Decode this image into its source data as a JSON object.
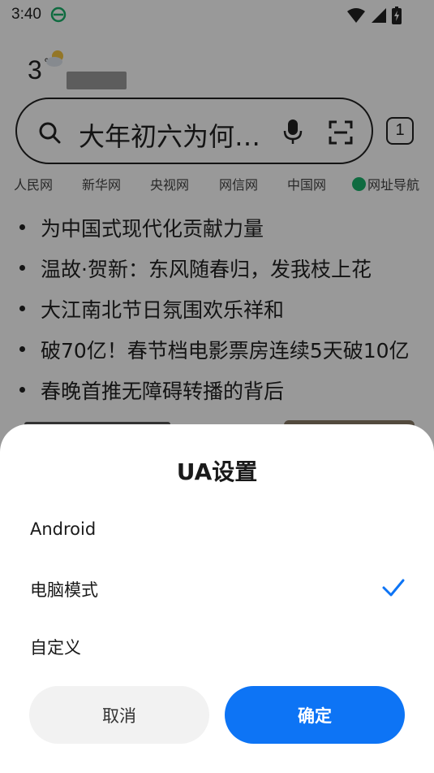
{
  "status_bar": {
    "time": "3:40"
  },
  "weather": {
    "temperature": "3",
    "degree": "°"
  },
  "search": {
    "query": "大年初六为何…",
    "tab_count": "1"
  },
  "quick_links": [
    "人民网",
    "新华网",
    "央视网",
    "网信网",
    "中国网",
    "网址导航"
  ],
  "news": [
    "为中国式现代化贡献力量",
    "温故·贺新：东风随春归，发我枝上花",
    "大江南北节日氛围欢乐祥和",
    "破70亿！春节档电影票房连续5天破10亿",
    "春晚首推无障碍转播的背后"
  ],
  "sheet": {
    "title": "UA设置",
    "options": [
      "Android",
      "电脑模式",
      "自定义"
    ],
    "selected": "电脑模式",
    "cancel_label": "取消",
    "confirm_label": "确定"
  },
  "colors": {
    "accent": "#0d74f5",
    "scrim": "rgba(0,0,0,0.4)",
    "nav_icon": "#19b36b"
  }
}
